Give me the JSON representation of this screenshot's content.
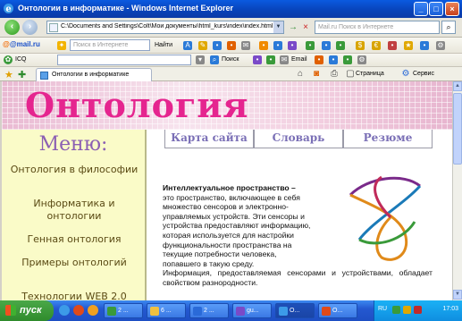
{
  "window": {
    "title": "Онтологии в информатике - Windows Internet Explorer"
  },
  "address_bar": {
    "url": "C:\\Documents and Settings\\Colt\\Мои документы\\html_kurs\\index\\index.html"
  },
  "search": {
    "placeholder": "Mail.ru Поиск в Интернете"
  },
  "mailru_toolbar": {
    "brand": "@mail.ru",
    "search_placeholder": "Поиск в Интернете",
    "find_label": "Найти"
  },
  "icq_toolbar": {
    "brand": "ICQ",
    "search_label": "Поиск",
    "email_label": "Email"
  },
  "tab": {
    "label": "Онтологии в информатике"
  },
  "commands": {
    "page_label": "Страница",
    "service_label": "Сервис"
  },
  "page": {
    "banner_title": "Онтология",
    "menu_title": "Меню:",
    "menu_items": [
      "Онтология в философии",
      "Информатика и онтологии",
      "Генная онтология",
      "Примеры онтологий",
      "Технологии WEB 2.0"
    ],
    "nav": [
      "Карта сайта",
      "Словарь",
      "Резюме"
    ],
    "content_lead": "Интеллектуальное пространство",
    "content_dash": " –",
    "content_lines": [
      "это пространство, включающее в себя",
      "множество сенсоров и электронно-",
      "управляемых устройств. Эти сенсоры и",
      "устройства предоставляют информацию,",
      "которая используется для настройки",
      "функциональности пространства на",
      "текущие потребности человека,",
      "попавшего в такую среду."
    ],
    "content_tail": "Информация, предоставляемая сенсорами и устройствами, обладает свойством разнородности."
  },
  "taskbar": {
    "start_label": "пуск",
    "tasks": [
      "2 ...",
      "6 ...",
      "2 ...",
      "gu...",
      "О...",
      "О..."
    ],
    "language": "RU",
    "clock": "17:03"
  },
  "colors": {
    "banner_title": "#e5258f",
    "menu_title": "#8b5fb3",
    "menu_bg": "#fafbc8"
  }
}
